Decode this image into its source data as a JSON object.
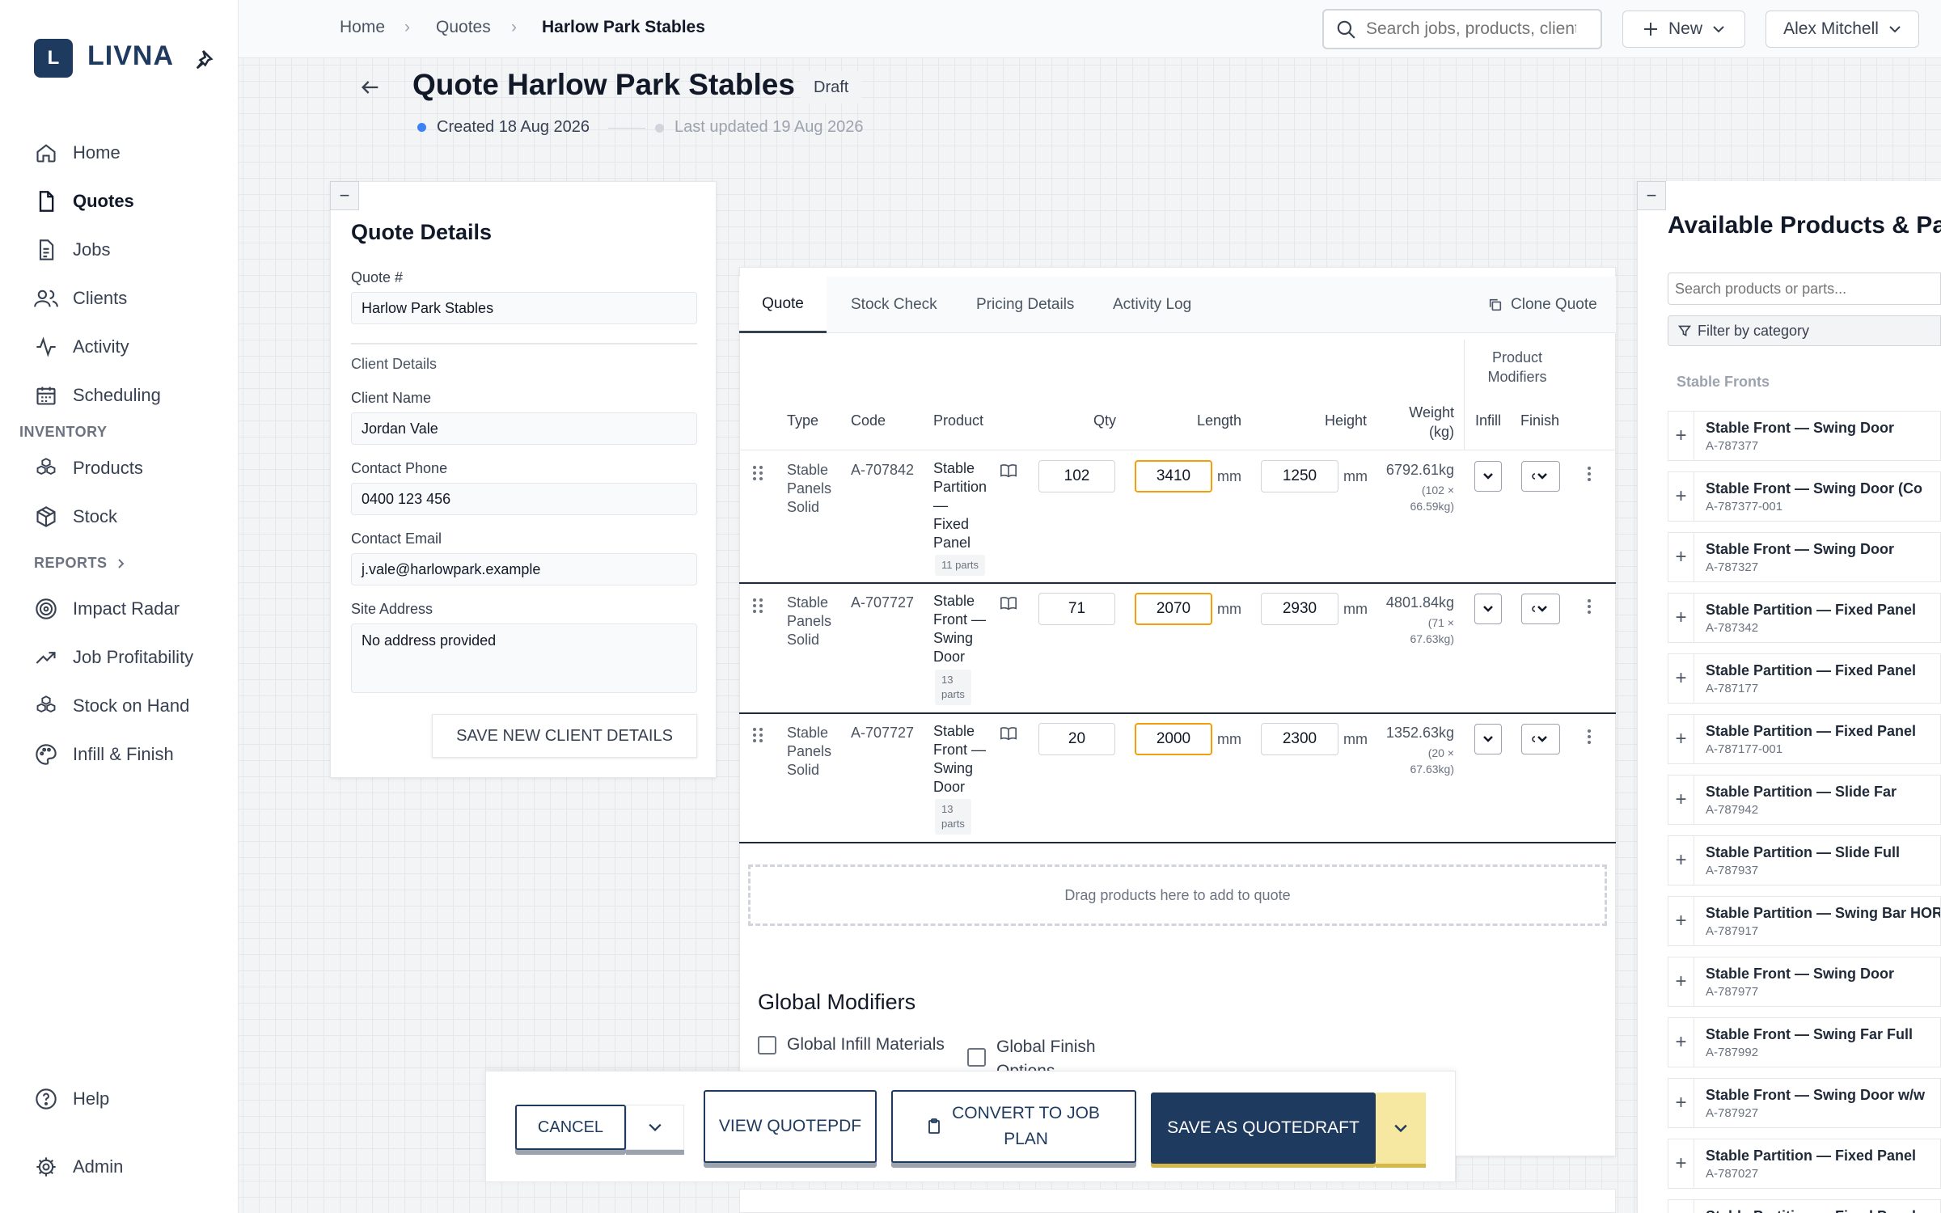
{
  "app": {
    "logo_letter": "L",
    "name": "LIVNA"
  },
  "nav": {
    "home": "Home",
    "quotes": "Quotes",
    "jobs": "Jobs",
    "clients": "Clients",
    "activity": "Activity",
    "scheduling": "Scheduling",
    "inventory_label": "INVENTORY",
    "products": "Products",
    "stock": "Stock",
    "reports_label": "REPORTS",
    "impact_radar": "Impact Radar",
    "job_profitability": "Job Profitability",
    "stock_on_hand": "Stock on Hand",
    "infill_finish": "Infill & Finish",
    "help": "Help",
    "admin": "Admin"
  },
  "breadcrumb": {
    "home": "Home",
    "quotes": "Quotes",
    "current": "Harlow Park Stables"
  },
  "topbar": {
    "search_placeholder": "Search jobs, products, clients",
    "new_label": "New",
    "user": "Alex Mitchell"
  },
  "page": {
    "title": "Quote Harlow Park Stables",
    "status": "Draft",
    "created": "Created 18 Aug 2026",
    "updated": "Last updated 19 Aug 2026"
  },
  "details": {
    "heading": "Quote Details",
    "quote_no_label": "Quote #",
    "quote_no": "Harlow Park Stables",
    "client_section": "Client Details",
    "client_name_label": "Client Name",
    "client_name": "Jordan Vale",
    "phone_label": "Contact Phone",
    "phone": "0400 123 456",
    "email_label": "Contact Email",
    "email": "j.vale@harlowpark.example",
    "address_label": "Site Address",
    "address": "No address provided",
    "save_btn": "SAVE NEW CLIENT DETAILS"
  },
  "tabs": {
    "quote": "Quote",
    "stock": "Stock Check",
    "pricing": "Pricing Details",
    "activity": "Activity Log",
    "clone": "Clone Quote"
  },
  "table": {
    "headers": {
      "type": "Type",
      "code": "Code",
      "product": "Product",
      "qty": "Qty",
      "length": "Length",
      "height": "Height",
      "weight1": "Weight",
      "weight2": "(kg)",
      "modifiers1": "Product",
      "modifiers2": "Modifiers",
      "infill": "Infill",
      "finish": "Finish"
    },
    "unit": "mm",
    "rows": [
      {
        "type": [
          "Stable",
          "Panels",
          "Solid"
        ],
        "code": "A-707842",
        "product": [
          "Stable",
          "Partition",
          "—",
          "Fixed",
          "Panel"
        ],
        "parts": "11 parts",
        "qty": "102",
        "length": "3410",
        "height": "1250",
        "weight": "6792.61kg",
        "breakdown": [
          "(102 ×",
          "66.59kg)"
        ]
      },
      {
        "type": [
          "Stable",
          "Panels",
          "Solid"
        ],
        "code": "A-707727",
        "product": [
          "Stable",
          "Front —",
          "Swing",
          "Door"
        ],
        "parts": [
          "13",
          "parts"
        ],
        "qty": "71",
        "length": "2070",
        "height": "2930",
        "weight": "4801.84kg",
        "breakdown": [
          "(71 ×",
          "67.63kg)"
        ]
      },
      {
        "type": [
          "Stable",
          "Panels",
          "Solid"
        ],
        "code": "A-707727",
        "product": [
          "Stable",
          "Front —",
          "Swing",
          "Door"
        ],
        "parts": [
          "13",
          "parts"
        ],
        "qty": "20",
        "length": "2000",
        "height": "2300",
        "weight": "1352.63kg",
        "breakdown": [
          "(20 ×",
          "67.63kg)"
        ]
      }
    ],
    "dropzone": "Drag products here to add to quote"
  },
  "global": {
    "heading": "Global Modifiers",
    "infill": "Global Infill Materials",
    "finish": [
      "Global Finish",
      "Options"
    ]
  },
  "actions": {
    "cancel": "CANCEL",
    "view_pdf": [
      "VIEW QUOTE",
      "PDF"
    ],
    "convert": [
      "CONVERT TO JOB",
      "PLAN"
    ],
    "save": [
      "SAVE AS QUOTE",
      "DRAFT"
    ]
  },
  "products_panel": {
    "heading": "Available Products & Parts",
    "search_placeholder": "Search products or parts...",
    "filter": "Filter by category",
    "category": "Stable Fronts",
    "items": [
      {
        "name": "Stable Front — Swing Door",
        "code": "A-787377"
      },
      {
        "name": "Stable Front — Swing Door (Co",
        "code": "A-787377-001"
      },
      {
        "name": "Stable Front — Swing Door",
        "code": "A-787327"
      },
      {
        "name": "Stable Partition — Fixed Panel",
        "code": "A-787342"
      },
      {
        "name": "Stable Partition — Fixed Panel",
        "code": "A-787177"
      },
      {
        "name": "Stable Partition — Fixed Panel",
        "code": "A-787177-001"
      },
      {
        "name": "Stable Partition — Slide Far",
        "code": "A-787942"
      },
      {
        "name": "Stable Partition — Slide Full",
        "code": "A-787937"
      },
      {
        "name": "Stable Partition — Swing Bar HOR",
        "code": "A-787917"
      },
      {
        "name": "Stable Front — Swing Door",
        "code": "A-787977"
      },
      {
        "name": "Stable Front — Swing Far Full",
        "code": "A-787992"
      },
      {
        "name": "Stable Front — Swing Door w/w",
        "code": "A-787927"
      },
      {
        "name": "Stable Partition — Fixed Panel",
        "code": "A-787027"
      },
      {
        "name": "Stable Partition — Fixed Panel",
        "code": ""
      }
    ]
  },
  "colors": {
    "brand": "#1e3a5f",
    "highlight": "#f59e0b",
    "save_dropdown": "#f6e7a1",
    "status_dot": "#3b82f6"
  }
}
